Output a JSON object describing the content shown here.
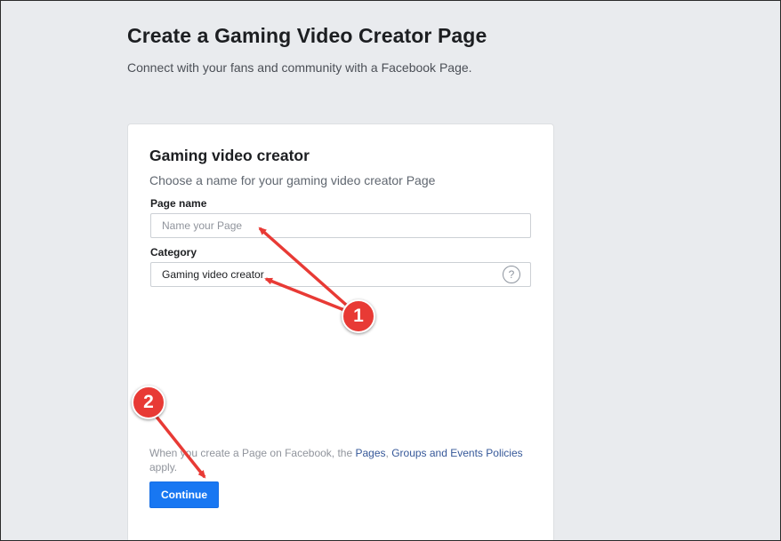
{
  "header": {
    "title": "Create a Gaming Video Creator Page",
    "subtitle": "Connect with your fans and community with a Facebook Page."
  },
  "card": {
    "title": "Gaming video creator",
    "description": "Choose a name for your gaming video creator Page",
    "page_name": {
      "label": "Page name",
      "placeholder": "Name your Page",
      "value": ""
    },
    "category": {
      "label": "Category",
      "value": "Gaming video creator",
      "help_icon_text": "?"
    },
    "policy": {
      "prefix": "When you create a Page on Facebook, the ",
      "link_pages": "Pages",
      "sep1": ", ",
      "link_groups": "Groups",
      "sep2": " and ",
      "link_events": "Events",
      "sep3": " ",
      "link_policies": "Policies",
      "suffix": " apply."
    },
    "continue_label": "Continue"
  },
  "annotations": {
    "badge_1": "1",
    "badge_2": "2",
    "color": "#e83a35"
  },
  "colors": {
    "background": "#e9ebee",
    "primary_button": "#1877f2",
    "link": "#365899"
  }
}
